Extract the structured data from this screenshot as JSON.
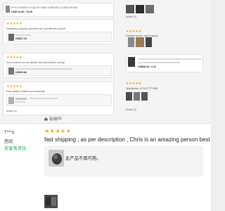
{
  "collage": {
    "r1_title": "NYYN GHJMOS HYLQK SH FJNNT XHPA NNTL SJJNDS RKYBG",
    "r1_price": "US$714.36 / 76.00",
    "r2_text": "Satisfactory shipping experience and cost-effective product!",
    "r2_price": "US$17.24",
    "r3_text": "Good customer service attitude and quick problem solving!",
    "r3_price": "US$19.84",
    "r4_text": "Easy quality is reliable and trustworthy!",
    "r4_helpful": "Helpful (0)",
    "right_r1_text": "Excellent service, rapid shipping",
    "right_r1_price": "US$68.26 / 1.11",
    "right_r2_text": "Specification: #1 DKG TPT BKB",
    "right_r2_helpful": "Helpful (0)",
    "top_helpful": "Helpful (0)"
  },
  "review": {
    "reviewer_name": "T***d",
    "country": "西班",
    "badge": "买家秀评论",
    "rating_stars": "★★★★★",
    "rating_value": 5,
    "text": "fast shipping , as per description , Chris is an amazing person best customer serv",
    "translated_text": "此产品不再可用。",
    "helpful_label": "有用",
    "helpful_count": "(0)"
  },
  "colors": {
    "star": "#f5a623",
    "badge_green": "#17a845"
  },
  "icons": {
    "thumbs_up": "thumbs-up-icon"
  }
}
